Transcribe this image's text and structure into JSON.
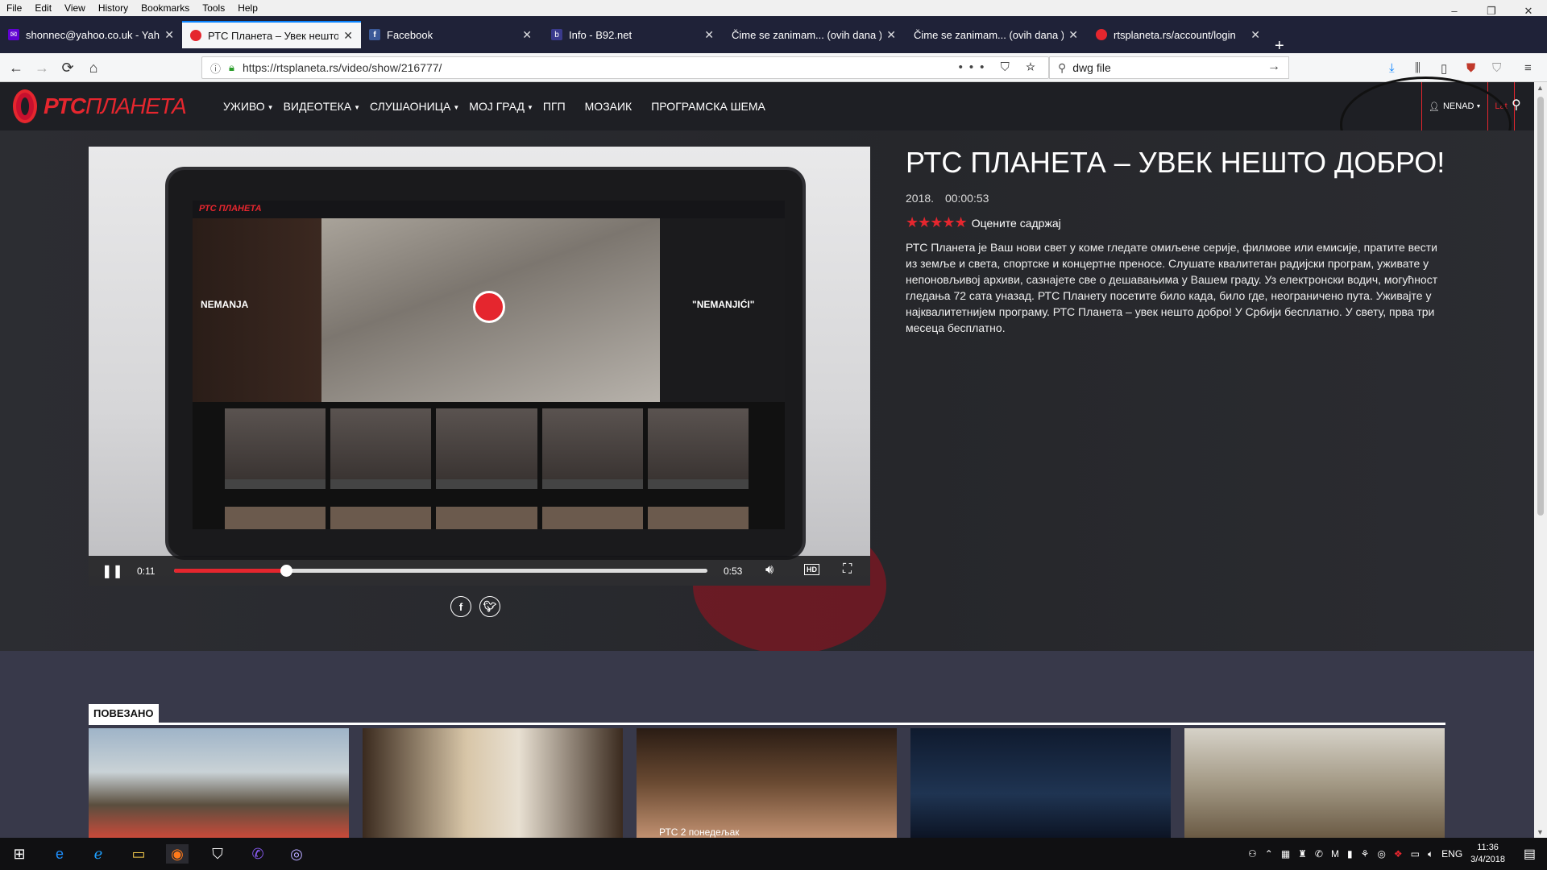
{
  "menubar": {
    "items": [
      "File",
      "Edit",
      "View",
      "History",
      "Bookmarks",
      "Tools",
      "Help"
    ]
  },
  "window_controls": {
    "minimize": "–",
    "restore": "❐",
    "close": "✕"
  },
  "tabs": [
    {
      "title": "shonnec@yahoo.co.uk - Yahoo",
      "favicon_color": "#6001d2",
      "favicon_glyph": "✉"
    },
    {
      "title": "РТС Планета – Увек нешто до",
      "favicon_color": "#e5262e",
      "favicon_glyph": "●",
      "active": true
    },
    {
      "title": "Facebook",
      "favicon_color": "#3b5998",
      "favicon_glyph": "f"
    },
    {
      "title": "Info - B92.net",
      "favicon_color": "#3a3a8c",
      "favicon_glyph": "b"
    },
    {
      "title": "Čime se zanimam... (ovih dana ) - F",
      "favicon_color": "#1f2238",
      "favicon_glyph": ""
    },
    {
      "title": "Čime se zanimam... (ovih dana ) - F",
      "favicon_color": "#1f2238",
      "favicon_glyph": ""
    },
    {
      "title": "rtsplaneta.rs/account/login",
      "favicon_color": "#e5262e",
      "favicon_glyph": "●"
    }
  ],
  "newtab_label": "+",
  "nav": {
    "url": "https://rtsplaneta.rs/video/show/216777/",
    "search_value": "dwg file",
    "url_actions": "••• ⛉ ☆"
  },
  "site": {
    "logo_bold": "РТС",
    "logo_rest": "ПЛАНЕТА",
    "nav_items": [
      {
        "label": "УЖИВО",
        "dropdown": true
      },
      {
        "label": "ВИДЕОТЕКА",
        "dropdown": true
      },
      {
        "label": "СЛУШАОНИЦА",
        "dropdown": true
      },
      {
        "label": "МОЈ ГРАД",
        "dropdown": true
      },
      {
        "label": "ПГП",
        "dropdown": false
      },
      {
        "label": "МОЗАИК",
        "dropdown": false
      },
      {
        "label": "ПРОГРАМСКА ШЕМА",
        "dropdown": false
      }
    ],
    "user_label": "NENAD",
    "lang_label": "Lat"
  },
  "player": {
    "current_time": "0:11",
    "duration": "0:53",
    "progress_fraction": 0.21,
    "hd_label": "HD",
    "inner_label_left": "NEMANJA",
    "inner_label_right": "\"NEMANJIĆI\""
  },
  "video": {
    "title": "РТС ПЛАНЕТА – УВЕК НЕШТО ДОБРО!",
    "year": "2018.",
    "length": "00:00:53",
    "stars": "★★★★★",
    "rate_label": "Оцените садржај",
    "description": "РТС Планета је Ваш нови свет у коме гледате омиљене серије, филмове или емисије, пратите вести из земље и света, спортске и концертне преносе. Слушате квалитетан радијски програм, уживате у непоновљивој архиви, сазнајете све о дешавањима у Вашем граду. Уз електронски водич, могућност гледања 72 сата уназад. РТС Планету посетите било када, било где, неограничено пута. Уживајте у најквалитетнијем програму. РТС Планета – увек нешто добро! У Србији бесплатно. У свету, прва три месеца бесплатно."
  },
  "related": {
    "heading": "ПОВЕЗАНО",
    "thumb_caption": "РТС 2 понедељак"
  },
  "taskbar": {
    "lang": "ENG",
    "time": "11:36",
    "date": "3/4/2018"
  }
}
